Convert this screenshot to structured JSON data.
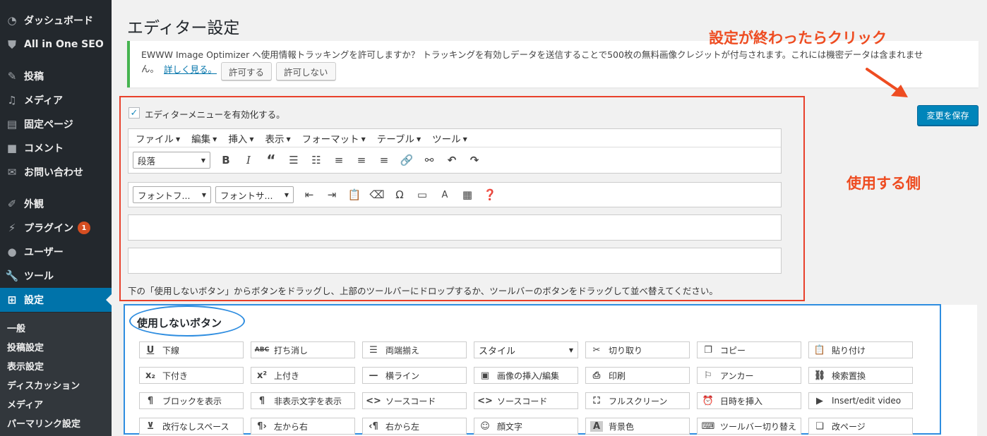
{
  "sidebar": {
    "menu": [
      {
        "label": "ダッシュボード",
        "icon": "dashboard-icon"
      },
      {
        "label": "All in One SEO",
        "icon": "shield-icon"
      },
      {
        "label": "投稿",
        "icon": "pin-icon"
      },
      {
        "label": "メディア",
        "icon": "media-icon"
      },
      {
        "label": "固定ページ",
        "icon": "page-icon"
      },
      {
        "label": "コメント",
        "icon": "comment-icon"
      },
      {
        "label": "お問い合わせ",
        "icon": "mail-icon"
      },
      {
        "label": "外観",
        "icon": "brush-icon"
      },
      {
        "label": "プラグイン",
        "icon": "plugin-icon",
        "badge": "1"
      },
      {
        "label": "ユーザー",
        "icon": "user-icon"
      },
      {
        "label": "ツール",
        "icon": "wrench-icon"
      },
      {
        "label": "設定",
        "icon": "settings-icon"
      }
    ],
    "submenu": [
      "一般",
      "投稿設定",
      "表示設定",
      "ディスカッション",
      "メディア",
      "パーマリンク設定"
    ]
  },
  "page": {
    "title": "エディター設定",
    "save_button": "変更を保存"
  },
  "notice": {
    "text": "EWWW Image Optimizer へ使用情報トラッキングを許可しますか？ トラッキングを有効しデータを送信することで500枚の無料画像クレジットが付与されます。これには機密データは含まれませ",
    "text_line2": "ん。",
    "link": "詳しく見る。",
    "allow": "許可する",
    "deny": "許可しない"
  },
  "annotations": {
    "click_after": "設定が終わったらクリック",
    "use_side": "使用する側",
    "accent": "#ee4c21",
    "blue": "#2e8de0"
  },
  "editor": {
    "enable_label": "エディターメニューを有効化する。",
    "menubar": [
      "ファイル",
      "編集",
      "挿入",
      "表示",
      "フォーマット",
      "テーブル",
      "ツール"
    ],
    "format_select": "段落",
    "font_family_select": "フォントフ...",
    "font_size_select": "フォントサ...",
    "instructions": "下の「使用しないボタン」からボタンをドラッグし、上部のツールバーにドロップするか、ツールバーのボタンをドラッグして並べ替えてください。"
  },
  "unused": {
    "title": "使用しないボタン",
    "buttons": [
      {
        "label": "下線",
        "icon": "underline-icon"
      },
      {
        "label": "打ち消し",
        "icon": "strikethrough-icon"
      },
      {
        "label": "両端揃え",
        "icon": "justify-icon"
      },
      {
        "label": "スタイル",
        "icon": "style-select"
      },
      {
        "label": "切り取り",
        "icon": "scissors-icon"
      },
      {
        "label": "コピー",
        "icon": "copy-icon"
      },
      {
        "label": "貼り付け",
        "icon": "paste-icon"
      },
      {
        "label": "下付き",
        "icon": "subscript-icon"
      },
      {
        "label": "上付き",
        "icon": "superscript-icon"
      },
      {
        "label": "横ライン",
        "icon": "hr-icon"
      },
      {
        "label": "画像の挿入/編集",
        "icon": "image-icon"
      },
      {
        "label": "印刷",
        "icon": "print-icon"
      },
      {
        "label": "アンカー",
        "icon": "anchor-icon"
      },
      {
        "label": "検索置換",
        "icon": "search-replace-icon"
      },
      {
        "label": "ブロックを表示",
        "icon": "show-blocks-icon"
      },
      {
        "label": "非表示文字を表示",
        "icon": "invisible-chars-icon"
      },
      {
        "label": "ソースコード",
        "icon": "code-icon"
      },
      {
        "label": "ソースコード",
        "icon": "code-icon"
      },
      {
        "label": "フルスクリーン",
        "icon": "fullscreen-icon"
      },
      {
        "label": "日時を挿入",
        "icon": "clock-icon"
      },
      {
        "label": "Insert/edit video",
        "icon": "video-icon"
      },
      {
        "label": "改行なしスペース",
        "icon": "nbsp-icon"
      },
      {
        "label": "左から右",
        "icon": "ltr-icon"
      },
      {
        "label": "右から左",
        "icon": "rtl-icon"
      },
      {
        "label": "顔文字",
        "icon": "emoticon-icon"
      },
      {
        "label": "背景色",
        "icon": "bg-color-icon"
      },
      {
        "label": "ツールバー切り替え",
        "icon": "keyboard-icon"
      },
      {
        "label": "改ページ",
        "icon": "page-break-icon"
      }
    ]
  }
}
